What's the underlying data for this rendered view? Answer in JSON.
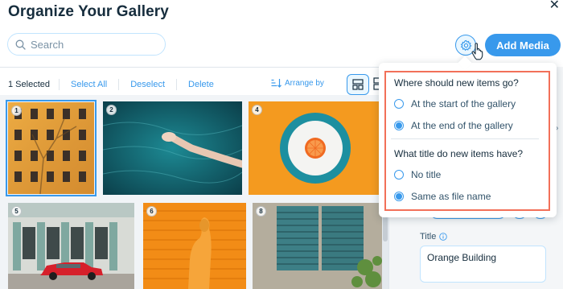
{
  "header": {
    "title": "Organize Your Gallery",
    "close_icon": "close-icon"
  },
  "search": {
    "placeholder": "Search",
    "value": ""
  },
  "actions": {
    "add_media_label": "Add Media",
    "settings_icon": "gear-icon"
  },
  "toolbar": {
    "selected_count": "1 Selected",
    "select_all": "Select All",
    "deselect": "Deselect",
    "delete": "Delete",
    "arrange_by": "Arrange by"
  },
  "gallery": {
    "items": [
      {
        "number": "1",
        "subject": "orange building",
        "selected": true
      },
      {
        "number": "2",
        "subject": "hand in water",
        "selected": false
      },
      {
        "number": "4",
        "subject": "orange on plate",
        "selected": false
      },
      {
        "number": "5",
        "subject": "red car",
        "selected": false
      },
      {
        "number": "6",
        "subject": "orange hoodie",
        "selected": false
      },
      {
        "number": "8",
        "subject": "green shutters",
        "selected": false
      }
    ]
  },
  "settings_popover": {
    "q1": "Where should new items go?",
    "q1_options": [
      {
        "label": "At the start of the gallery",
        "checked": false
      },
      {
        "label": "At the end of the gallery",
        "checked": true
      }
    ],
    "q2": "What title do new items have?",
    "q2_options": [
      {
        "label": "No title",
        "checked": false
      },
      {
        "label": "Same as file name",
        "checked": true
      }
    ]
  },
  "details_panel": {
    "title_label": "Title",
    "title_value": "Orange Building"
  },
  "colors": {
    "accent": "#3899ec",
    "text": "#162d3d",
    "highlight_frame": "#f27059"
  }
}
